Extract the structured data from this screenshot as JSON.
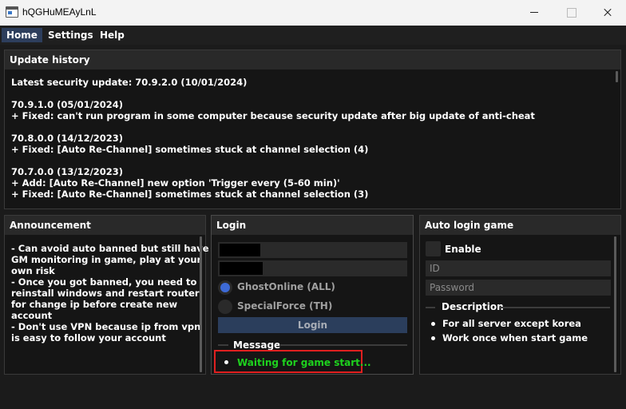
{
  "window": {
    "title": "hQGHuMEAyLnL"
  },
  "menu": {
    "items": [
      "Home",
      "Settings",
      "Help"
    ]
  },
  "update_history": {
    "title": "Update history",
    "lines": [
      "Latest security update: 70.9.2.0 (10/01/2024)",
      "",
      "70.9.1.0 (05/01/2024)",
      "+ Fixed: can't run program in some computer because security update after big update of anti-cheat",
      "",
      "70.8.0.0 (14/12/2023)",
      "+ Fixed: [Auto Re-Channel] sometimes stuck at channel selection (4)",
      "",
      "70.7.0.0 (13/12/2023)",
      "+ Add: [Auto Re-Channel] new option 'Trigger every (5-60 min)'",
      "+ Fixed: [Auto Re-Channel] sometimes stuck at channel selection (3)"
    ]
  },
  "announcement": {
    "title": "Announcement",
    "lines": [
      "- Can avoid auto banned but still have",
      "GM monitoring in game, play at your",
      "own risk",
      "- Once you got banned, you need to",
      "reinstall windows and restart router",
      "for change ip before create new",
      "account",
      "- Don't use VPN because ip from vpn",
      "is easy to follow your account"
    ]
  },
  "login": {
    "title": "Login",
    "options": [
      {
        "label": "GhostOnline (ALL)",
        "checked": true
      },
      {
        "label": "SpecialForce (TH)",
        "checked": false
      }
    ],
    "button": "Login",
    "message_header": "Message",
    "message": "Waiting for game start...",
    "message_color": "#1ed21e"
  },
  "auto_login": {
    "title": "Auto login game",
    "enable_label": "Enable",
    "enabled": false,
    "id_placeholder": "ID",
    "password_placeholder": "Password",
    "description_header": "Description",
    "description": [
      "For all server except korea",
      "Work once when start game"
    ]
  }
}
